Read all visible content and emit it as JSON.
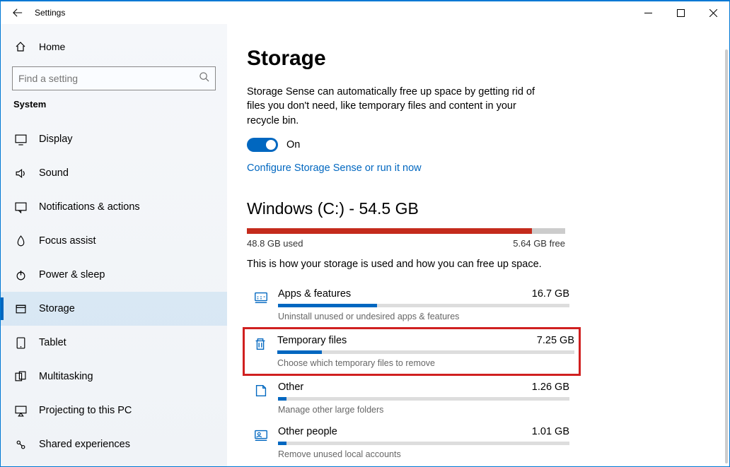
{
  "window": {
    "title": "Settings"
  },
  "sidebar": {
    "home_label": "Home",
    "search_placeholder": "Find a setting",
    "section": "System",
    "items": [
      {
        "key": "display",
        "label": "Display"
      },
      {
        "key": "sound",
        "label": "Sound"
      },
      {
        "key": "notifications",
        "label": "Notifications & actions"
      },
      {
        "key": "focus",
        "label": "Focus assist"
      },
      {
        "key": "power",
        "label": "Power & sleep"
      },
      {
        "key": "storage",
        "label": "Storage",
        "selected": true
      },
      {
        "key": "tablet",
        "label": "Tablet"
      },
      {
        "key": "multitasking",
        "label": "Multitasking"
      },
      {
        "key": "projecting",
        "label": "Projecting to this PC"
      },
      {
        "key": "shared",
        "label": "Shared experiences"
      }
    ]
  },
  "page": {
    "title": "Storage",
    "sense_desc": "Storage Sense can automatically free up space by getting rid of files you don't need, like temporary files and content in your recycle bin.",
    "toggle_label": "On",
    "configure_link": "Configure Storage Sense or run it now",
    "drive": {
      "title": "Windows (C:) - 54.5 GB",
      "used_pct": 89.6,
      "used_label": "48.8 GB used",
      "free_label": "5.64 GB free",
      "how_desc": "This is how your storage is used and how you can free up space."
    },
    "categories": [
      {
        "key": "apps",
        "label": "Apps & features",
        "size": "16.7 GB",
        "pct": 34,
        "sub": "Uninstall unused or undesired apps & features",
        "highlight": false
      },
      {
        "key": "temp",
        "label": "Temporary files",
        "size": "7.25 GB",
        "pct": 15,
        "sub": "Choose which temporary files to remove",
        "highlight": true
      },
      {
        "key": "other",
        "label": "Other",
        "size": "1.26 GB",
        "pct": 3,
        "sub": "Manage other large folders",
        "highlight": false
      },
      {
        "key": "people",
        "label": "Other people",
        "size": "1.01 GB",
        "pct": 3,
        "sub": "Remove unused local accounts",
        "highlight": false
      }
    ]
  }
}
